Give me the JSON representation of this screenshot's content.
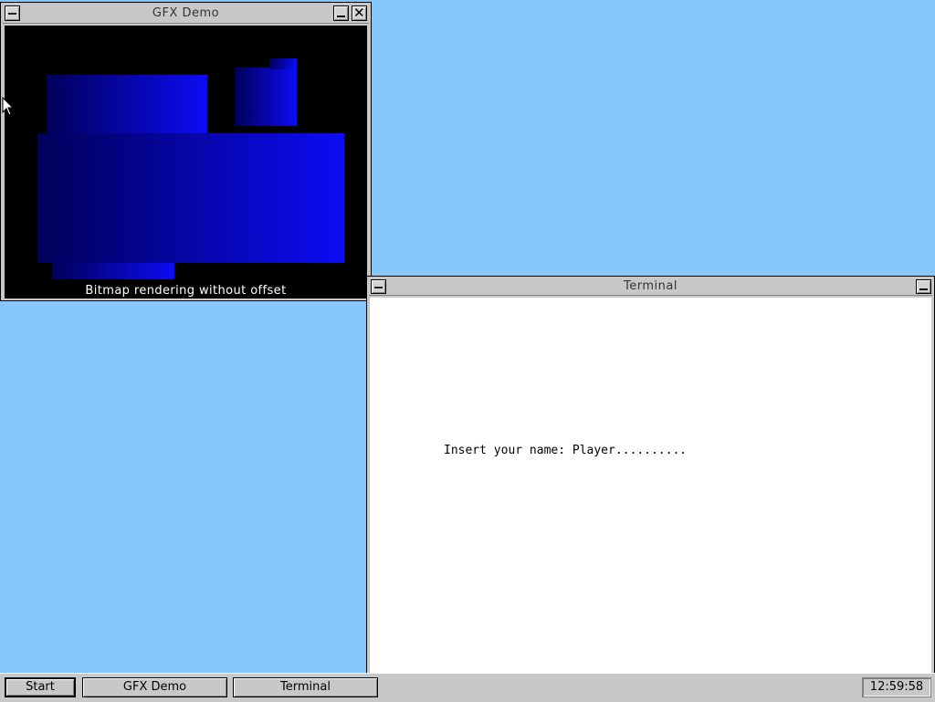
{
  "desktop": {
    "background": "#85c6fb"
  },
  "gfx_window": {
    "title": "GFX Demo",
    "caption": "Bitmap rendering without offset",
    "icons": [
      "system-menu-icon",
      "minimize-icon",
      "close-icon"
    ],
    "colors": {
      "fill_dark": "#00007a",
      "fill_bright": "#0a0af0",
      "h_lines": "#7fff50",
      "v_lines": "#ff2060"
    }
  },
  "terminal_window": {
    "title": "Terminal",
    "prompt": "Insert your name: Player.........."
  },
  "taskbar": {
    "start_label": "Start",
    "tasks": [
      {
        "label": "GFX Demo"
      },
      {
        "label": "Terminal"
      }
    ],
    "clock": "12:59:58"
  }
}
